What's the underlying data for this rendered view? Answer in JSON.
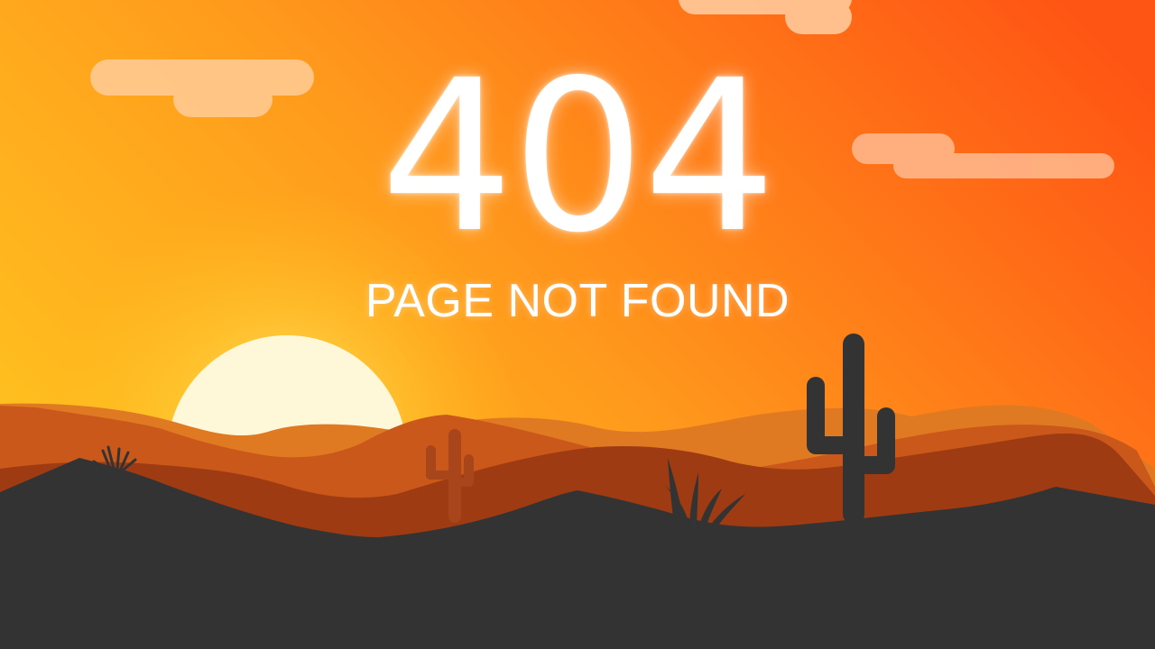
{
  "error": {
    "code": "404",
    "message": "PAGE NOT FOUND"
  },
  "colors": {
    "sky_left": "#ffc320",
    "sky_right": "#ff5a14",
    "sun": "#fff8d8",
    "sun_glow": "#ffe56a",
    "cloud": "#ffd7a8",
    "far_hills": "#e07a22",
    "mid_hills": "#c9581a",
    "near_hills": "#9e3b12",
    "ground": "#333333",
    "cactus_far": "#a8451a",
    "cactus_near": "#333333"
  },
  "icons": {
    "cactus_large": "cactus-icon",
    "cactus_small": "cactus-icon",
    "grass": "grass-tuft-icon"
  }
}
